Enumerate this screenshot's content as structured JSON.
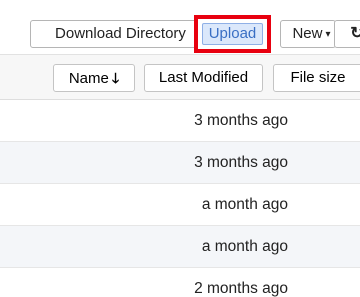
{
  "toolbar": {
    "download_label": "Download Directory",
    "upload_label": "Upload",
    "new_label": "New",
    "new_caret": "▾",
    "refresh_glyph": "↻"
  },
  "header": {
    "name_label": "Name",
    "name_sort_arrow": "🡓",
    "modified_label": "Last Modified",
    "size_label": "File size"
  },
  "rows": [
    {
      "modified": "3 months ago"
    },
    {
      "modified": "3 months ago"
    },
    {
      "modified": "a month ago"
    },
    {
      "modified": "a month ago"
    },
    {
      "modified": "2 months ago"
    }
  ],
  "colors": {
    "highlight": "#e8000f",
    "upload_bg": "#dbe8fb",
    "upload_text": "#3a6fc4"
  }
}
